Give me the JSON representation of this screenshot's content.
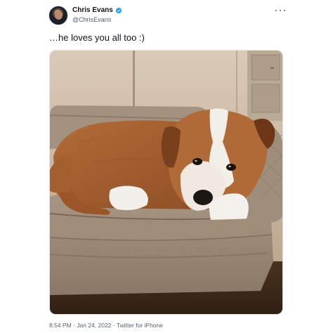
{
  "tweet": {
    "author": {
      "display_name": "Chris Evans",
      "handle": "@ChrisEvans",
      "verified": true
    },
    "text": "…he loves you all too :)",
    "photo": {
      "subject": "dog-on-bed"
    },
    "time": "8:54 PM",
    "separator": "·",
    "date": "Jan 24, 2022",
    "source": "Twitter for iPhone"
  },
  "colors": {
    "verified": "#1d9bf0",
    "secondary_text": "#536471",
    "primary_text": "#0f1419"
  },
  "icons": {
    "more": "more-horizontal-icon",
    "verified": "verified-badge-icon"
  }
}
